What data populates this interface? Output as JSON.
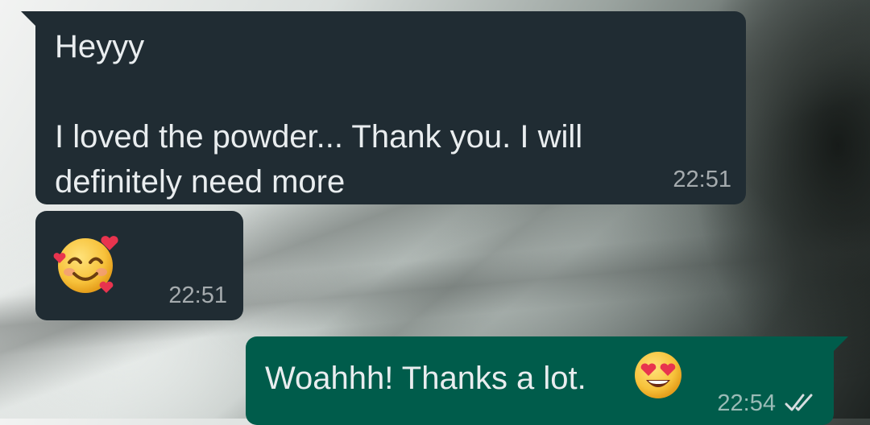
{
  "messages": [
    {
      "direction": "incoming",
      "text": "Heyyy\n\nI loved the powder... Thank you. I will definitely need more",
      "time": "22:51"
    },
    {
      "direction": "incoming",
      "emoji": "smiling-face-with-hearts",
      "time": "22:51"
    },
    {
      "direction": "outgoing",
      "text": "Woahhh! Thanks a lot.",
      "emoji": "heart-eyes",
      "time": "22:54",
      "status": "read"
    }
  ],
  "colors": {
    "incoming_bubble": "#202c33",
    "outgoing_bubble": "#005c4b",
    "text": "#e9edef",
    "meta": "#9ba5ab",
    "read_tick": "#d7dde0"
  }
}
